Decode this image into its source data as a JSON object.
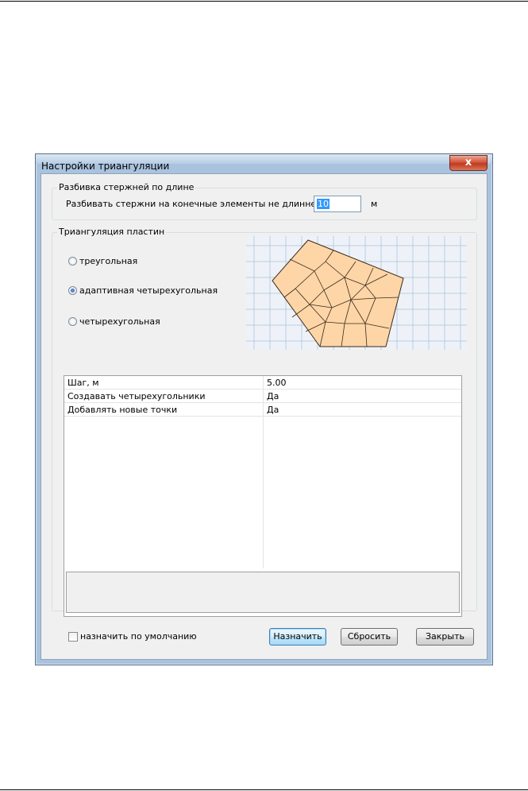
{
  "window": {
    "title": "Настройки триангуляции",
    "close_glyph": "x"
  },
  "bar_division": {
    "legend": "Разбивка стержней по длине",
    "label": "Разбивать стержни на конечные элементы не длиннее:",
    "value": "10",
    "unit": "м"
  },
  "plate_triangulation": {
    "legend": "Триангуляция пластин",
    "options": [
      {
        "label": "треугольная",
        "selected": false
      },
      {
        "label": "адаптивная четырехугольная",
        "selected": true
      },
      {
        "label": "четырехугольная",
        "selected": false
      }
    ],
    "preview_icon": "mesh-preview-icon"
  },
  "properties": [
    {
      "name": "Шаг, м",
      "value": "5.00"
    },
    {
      "name": "Создавать четырехугольники",
      "value": "Да"
    },
    {
      "name": "Добавлять новые точки",
      "value": "Да"
    }
  ],
  "footer": {
    "default_checkbox_label": "назначить по умолчанию",
    "default_checked": false,
    "buttons": {
      "assign": "Назначить",
      "reset": "Сбросить",
      "close": "Закрыть"
    }
  },
  "colors": {
    "mesh_fill": "#fdd5a7",
    "grid_bg": "#eef2f8",
    "selection": "#3399ff"
  }
}
